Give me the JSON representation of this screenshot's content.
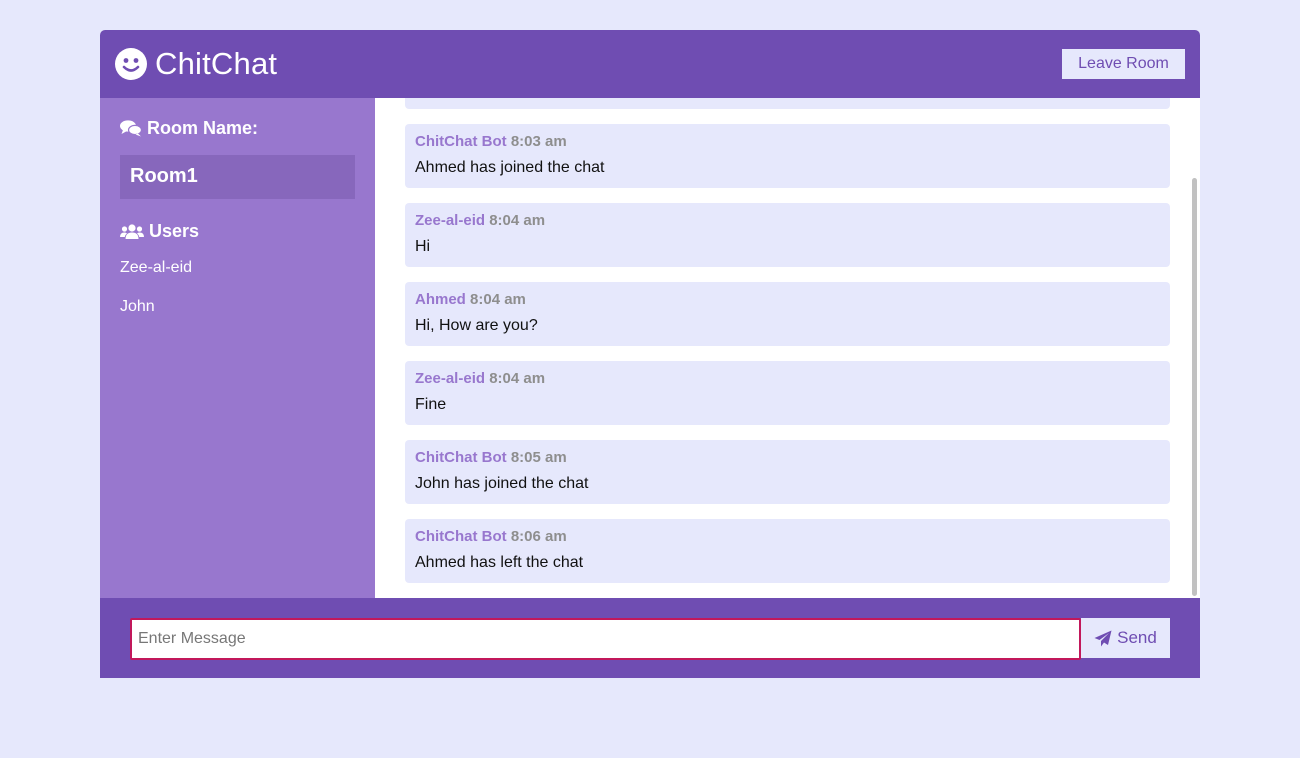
{
  "app": {
    "title": "ChitChat",
    "logo_icon": "smile-icon",
    "leave_button": "Leave Room"
  },
  "colors": {
    "primary": "#6f4db2",
    "sidebar": "#9877ce",
    "background": "#e6e8fc",
    "author": "#9877ce",
    "time": "#8e8e8e"
  },
  "sidebar": {
    "room_heading": "Room Name:",
    "room_icon": "comments-icon",
    "room_name": "Room1",
    "users_heading": "Users",
    "users_icon": "users-icon",
    "users": [
      "Zee-al-eid",
      "John"
    ]
  },
  "messages": [
    {
      "author": "ChitChat Bot",
      "time": "8:03 am",
      "text": "Ahmed has joined the chat"
    },
    {
      "author": "Zee-al-eid",
      "time": "8:04 am",
      "text": "Hi"
    },
    {
      "author": "Ahmed",
      "time": "8:04 am",
      "text": "Hi, How are you?"
    },
    {
      "author": "Zee-al-eid",
      "time": "8:04 am",
      "text": "Fine"
    },
    {
      "author": "ChitChat Bot",
      "time": "8:05 am",
      "text": "John has joined the chat"
    },
    {
      "author": "ChitChat Bot",
      "time": "8:06 am",
      "text": "Ahmed has left the chat"
    }
  ],
  "form": {
    "placeholder": "Enter Message",
    "value": "",
    "send_label": "Send",
    "send_icon": "paper-plane-icon"
  }
}
